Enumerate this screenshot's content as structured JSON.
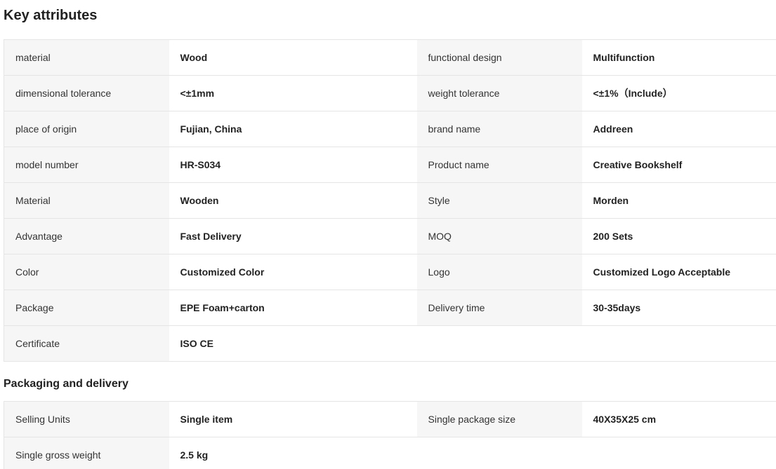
{
  "key_attributes": {
    "title": "Key attributes",
    "rows": [
      {
        "l1": "material",
        "v1": "Wood",
        "l2": "functional design",
        "v2": "Multifunction"
      },
      {
        "l1": "dimensional tolerance",
        "v1": "<±1mm",
        "l2": "weight tolerance",
        "v2": "<±1%（Include）"
      },
      {
        "l1": "place of origin",
        "v1": "Fujian, China",
        "l2": "brand name",
        "v2": "Addreen"
      },
      {
        "l1": "model number",
        "v1": "HR-S034",
        "l2": "Product name",
        "v2": "Creative Bookshelf"
      },
      {
        "l1": "Material",
        "v1": "Wooden",
        "l2": "Style",
        "v2": "Morden"
      },
      {
        "l1": "Advantage",
        "v1": "Fast Delivery",
        "l2": "MOQ",
        "v2": "200 Sets"
      },
      {
        "l1": "Color",
        "v1": "Customized Color",
        "l2": "Logo",
        "v2": "Customized Logo Acceptable"
      },
      {
        "l1": "Package",
        "v1": "EPE Foam+carton",
        "l2": "Delivery time",
        "v2": "30-35days"
      },
      {
        "l1": "Certificate",
        "v1": "ISO CE"
      }
    ]
  },
  "packaging_delivery": {
    "title": "Packaging and delivery",
    "rows": [
      {
        "l1": "Selling Units",
        "v1": "Single item",
        "l2": "Single package size",
        "v2": "40X35X25 cm"
      },
      {
        "l1": "Single gross weight",
        "v1": "2.5 kg"
      }
    ]
  }
}
